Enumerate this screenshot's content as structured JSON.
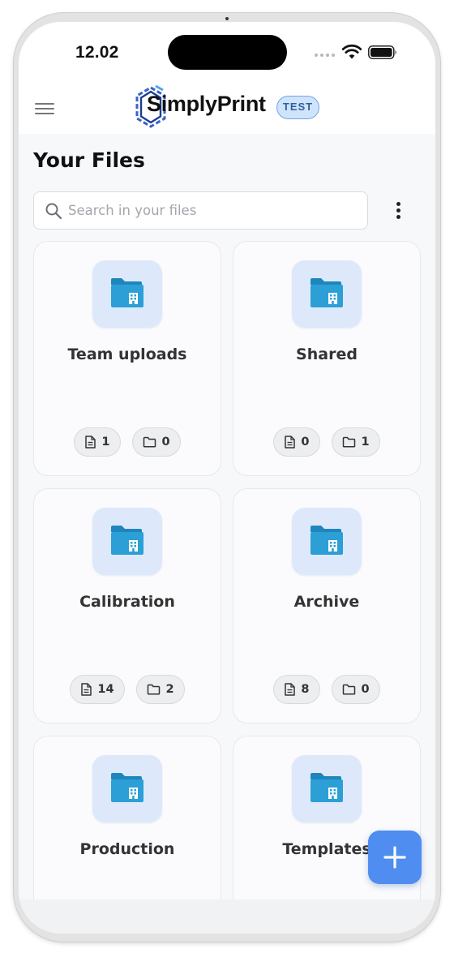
{
  "status_bar": {
    "time": "12.02"
  },
  "header": {
    "app_name": "SimplyPrint",
    "env_badge": "TEST"
  },
  "page": {
    "title": "Your Files"
  },
  "search": {
    "placeholder": "Search in your files",
    "value": ""
  },
  "folders": [
    {
      "name": "Team uploads",
      "files": "1",
      "folders": "0"
    },
    {
      "name": "Shared",
      "files": "0",
      "folders": "1"
    },
    {
      "name": "Calibration",
      "files": "14",
      "folders": "2"
    },
    {
      "name": "Archive",
      "files": "8",
      "folders": "0"
    },
    {
      "name": "Production"
    },
    {
      "name": "Templates"
    }
  ],
  "icons": {
    "menu": "hamburger-menu-icon",
    "logo": "simplyprint-hexagon-logo",
    "search": "search-icon",
    "more": "vertical-dots-icon",
    "folder": "folder-building-icon",
    "file_count": "file-icon",
    "folder_count": "folder-icon",
    "add": "plus-icon"
  },
  "colors": {
    "accent": "#4f8ef0",
    "badge_bg": "#cfe3fb",
    "folder_blue": "#2b9fd6",
    "tile_bg": "#dde9fb"
  }
}
